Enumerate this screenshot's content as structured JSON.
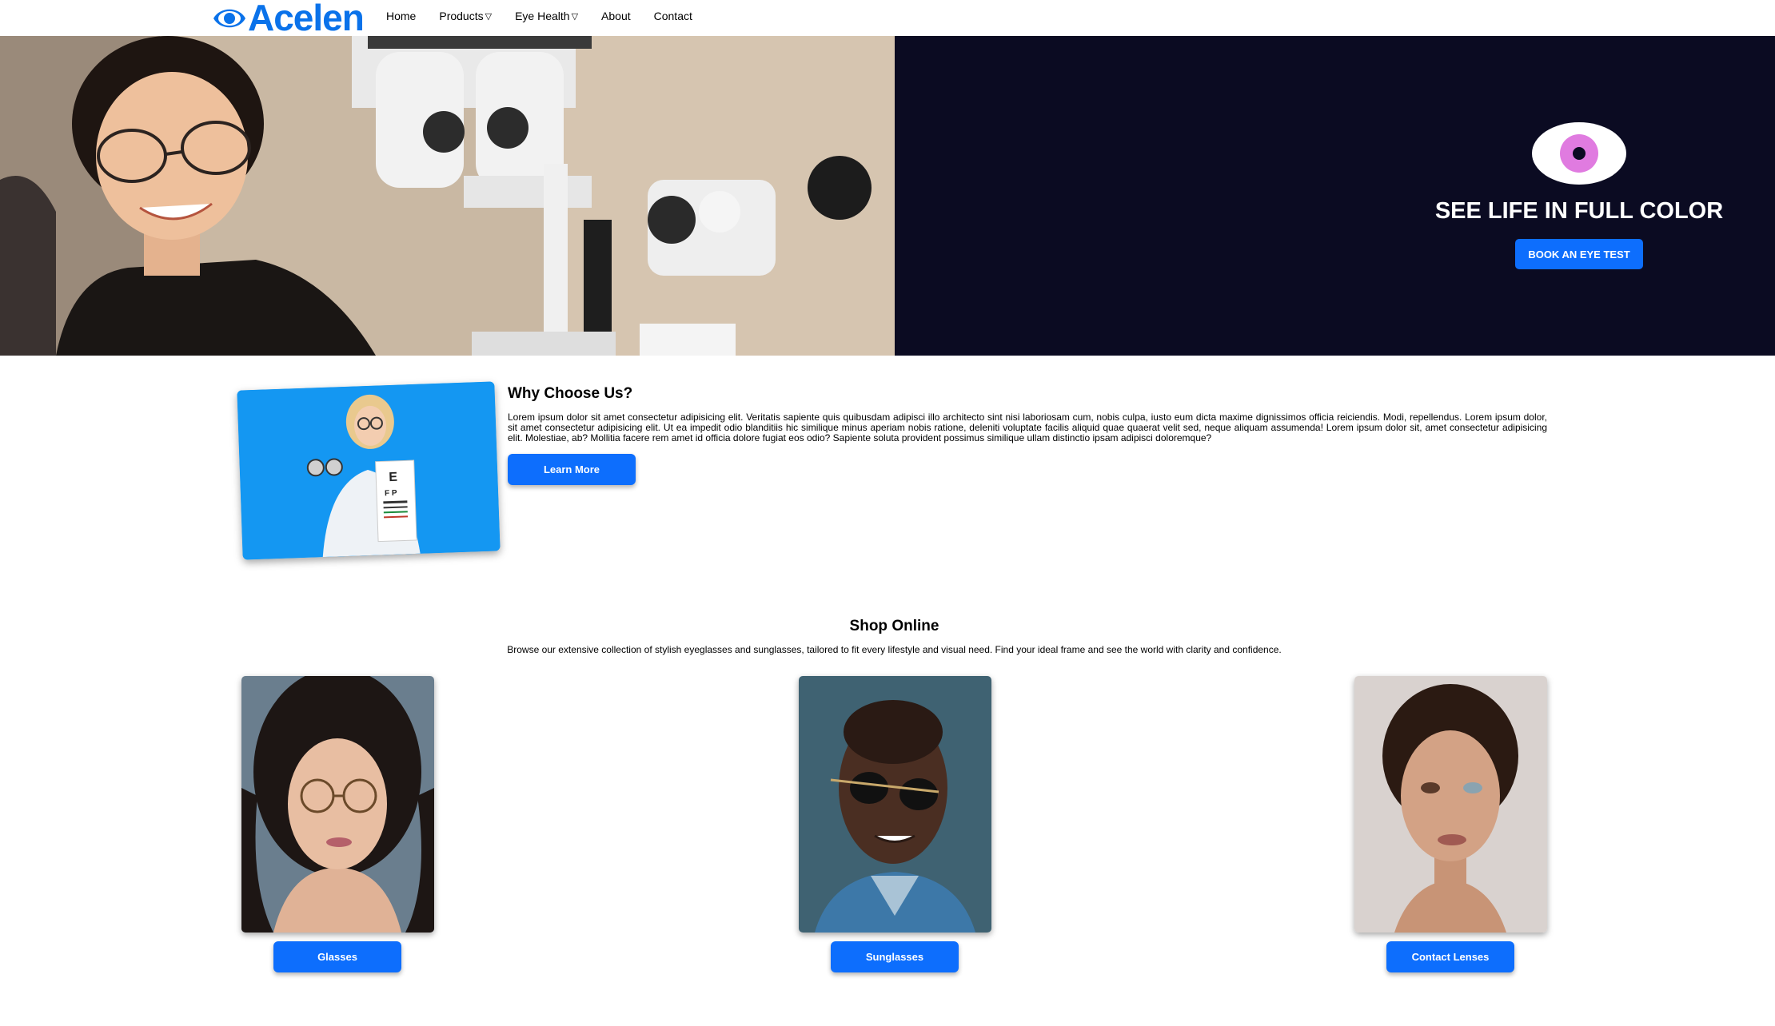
{
  "header": {
    "logo_text": "Acelen",
    "nav": [
      {
        "label": "Home",
        "has_caret": false
      },
      {
        "label": "Products",
        "has_caret": true
      },
      {
        "label": "Eye Health",
        "has_caret": true
      },
      {
        "label": "About",
        "has_caret": false
      },
      {
        "label": "Contact",
        "has_caret": false
      }
    ],
    "caret_glyph": "▽"
  },
  "hero": {
    "title": "SEE LIFE IN FULL COLOR",
    "button_label": "BOOK AN EYE TEST",
    "icon": "eye-icon"
  },
  "why": {
    "title": "Why Choose Us?",
    "text": "Lorem ipsum dolor sit amet consectetur adipisicing elit. Veritatis sapiente quis quibusdam adipisci illo architecto sint nisi laboriosam cum, nobis culpa, iusto eum dicta maxime dignissimos officia reiciendis. Modi, repellendus. Lorem ipsum dolor, sit amet consectetur adipisicing elit. Ut ea impedit odio blanditiis hic similique minus aperiam nobis ratione, deleniti voluptate facilis aliquid quae quaerat velit sed, neque aliquam assumenda! Lorem ipsum dolor sit, amet consectetur adipisicing elit. Molestiae, ab? Mollitia facere rem amet id officia dolore fugiat eos odio? Sapiente soluta provident possimus similique ullam distinctio ipsam adipisci doloremque?",
    "button_label": "Learn More"
  },
  "shop": {
    "title": "Shop Online",
    "description": "Browse our extensive collection of stylish eyeglasses and sunglasses, tailored to fit every lifestyle and visual need. Find your ideal frame and see the world with clarity and confidence.",
    "cards": [
      {
        "label": "Glasses"
      },
      {
        "label": "Sunglasses"
      },
      {
        "label": "Contact Lenses"
      }
    ]
  },
  "colors": {
    "brand_blue": "#0a72ea",
    "button_blue": "#0d6efd",
    "hero_dark": "#0b0b22",
    "eye_iris": "#e07be0"
  }
}
